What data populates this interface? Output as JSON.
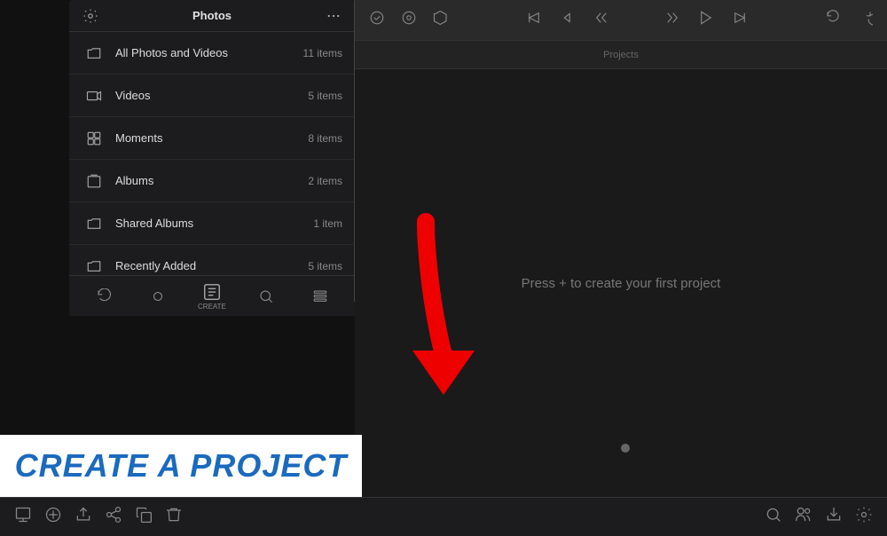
{
  "sidebar": {
    "title": "Photos",
    "items": [
      {
        "id": "all-photos",
        "label": "All Photos and Videos",
        "count": "11 items",
        "icon": "folder"
      },
      {
        "id": "videos",
        "label": "Videos",
        "count": "5 items",
        "icon": "video"
      },
      {
        "id": "moments",
        "label": "Moments",
        "count": "8 items",
        "icon": "moments"
      },
      {
        "id": "albums",
        "label": "Albums",
        "count": "2 items",
        "icon": "albums"
      },
      {
        "id": "shared-albums",
        "label": "Shared Albums",
        "count": "1 item",
        "icon": "folder"
      },
      {
        "id": "recently-added",
        "label": "Recently Added",
        "count": "5 items",
        "icon": "folder"
      }
    ],
    "toolbar": {
      "create_label": "CREATE"
    }
  },
  "main": {
    "projects_label": "Projects",
    "create_hint": "Press + to create your first project"
  },
  "bottom_toolbar": {
    "buttons_left": [
      "import",
      "add",
      "export",
      "share",
      "copy",
      "delete"
    ],
    "buttons_right": [
      "search",
      "users",
      "download",
      "settings"
    ]
  },
  "banner": {
    "text": "CREATE A PROJECT"
  }
}
